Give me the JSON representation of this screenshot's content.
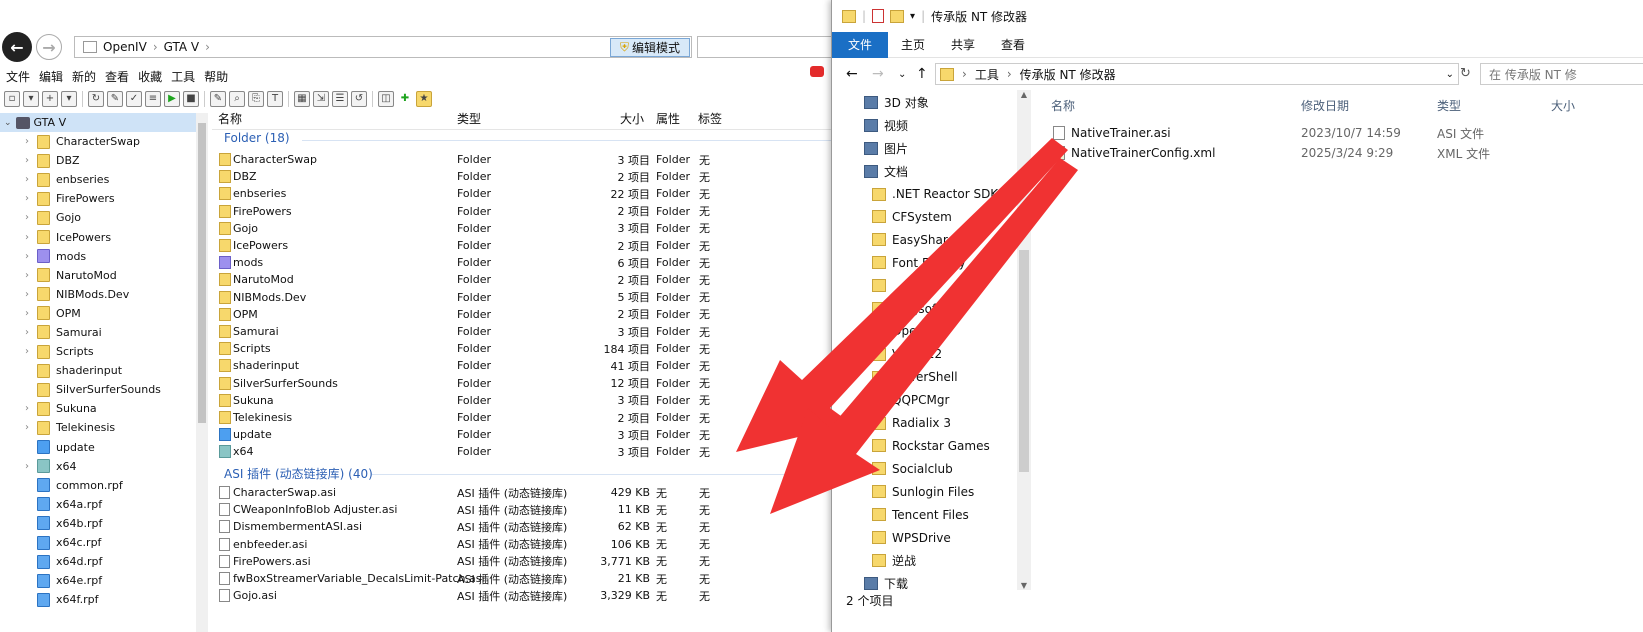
{
  "openiv": {
    "address": {
      "app": "OpenIV",
      "folder": "GTA V"
    },
    "edit_mode": "编辑模式",
    "menu": [
      "文件",
      "编辑",
      "新的",
      "查看",
      "收藏",
      "工具",
      "帮助"
    ],
    "tree_root": "GTA V",
    "tree": [
      {
        "label": "CharacterSwap",
        "icon": "folder"
      },
      {
        "label": "DBZ",
        "icon": "folder"
      },
      {
        "label": "enbseries",
        "icon": "folder"
      },
      {
        "label": "FirePowers",
        "icon": "folder"
      },
      {
        "label": "Gojo",
        "icon": "folder"
      },
      {
        "label": "IcePowers",
        "icon": "folder"
      },
      {
        "label": "mods",
        "icon": "purple"
      },
      {
        "label": "NarutoMod",
        "icon": "folder"
      },
      {
        "label": "NIBMods.Dev",
        "icon": "folder"
      },
      {
        "label": "OPM",
        "icon": "folder"
      },
      {
        "label": "Samurai",
        "icon": "folder"
      },
      {
        "label": "Scripts",
        "icon": "folder"
      },
      {
        "label": "shaderinput",
        "icon": "folder"
      },
      {
        "label": "SilverSurferSounds",
        "icon": "folder"
      },
      {
        "label": "Sukuna",
        "icon": "folder"
      },
      {
        "label": "Telekinesis",
        "icon": "folder"
      },
      {
        "label": "update",
        "icon": "blue"
      },
      {
        "label": "x64",
        "icon": "teal"
      },
      {
        "label": "common.rpf",
        "icon": "rpf"
      },
      {
        "label": "x64a.rpf",
        "icon": "rpf"
      },
      {
        "label": "x64b.rpf",
        "icon": "rpf"
      },
      {
        "label": "x64c.rpf",
        "icon": "rpf"
      },
      {
        "label": "x64d.rpf",
        "icon": "rpf"
      },
      {
        "label": "x64e.rpf",
        "icon": "rpf"
      },
      {
        "label": "x64f.rpf",
        "icon": "rpf"
      }
    ],
    "columns": {
      "name": "名称",
      "type": "类型",
      "size": "大小",
      "attr": "属性",
      "tag": "标签"
    },
    "group_folder": "Folder (18)",
    "group_asi": "ASI 插件 (动态链接库) (40)",
    "folders": [
      {
        "name": "CharacterSwap",
        "type": "Folder",
        "size": "3 项目",
        "attr": "Folder",
        "tag": "无"
      },
      {
        "name": "DBZ",
        "type": "Folder",
        "size": "2 项目",
        "attr": "Folder",
        "tag": "无"
      },
      {
        "name": "enbseries",
        "type": "Folder",
        "size": "22 项目",
        "attr": "Folder",
        "tag": "无"
      },
      {
        "name": "FirePowers",
        "type": "Folder",
        "size": "2 项目",
        "attr": "Folder",
        "tag": "无"
      },
      {
        "name": "Gojo",
        "type": "Folder",
        "size": "3 项目",
        "attr": "Folder",
        "tag": "无"
      },
      {
        "name": "IcePowers",
        "type": "Folder",
        "size": "2 项目",
        "attr": "Folder",
        "tag": "无"
      },
      {
        "name": "mods",
        "type": "Folder",
        "size": "6 项目",
        "attr": "Folder",
        "tag": "无"
      },
      {
        "name": "NarutoMod",
        "type": "Folder",
        "size": "2 项目",
        "attr": "Folder",
        "tag": "无"
      },
      {
        "name": "NIBMods.Dev",
        "type": "Folder",
        "size": "5 项目",
        "attr": "Folder",
        "tag": "无"
      },
      {
        "name": "OPM",
        "type": "Folder",
        "size": "2 项目",
        "attr": "Folder",
        "tag": "无"
      },
      {
        "name": "Samurai",
        "type": "Folder",
        "size": "3 项目",
        "attr": "Folder",
        "tag": "无"
      },
      {
        "name": "Scripts",
        "type": "Folder",
        "size": "184 项目",
        "attr": "Folder",
        "tag": "无"
      },
      {
        "name": "shaderinput",
        "type": "Folder",
        "size": "41 项目",
        "attr": "Folder",
        "tag": "无"
      },
      {
        "name": "SilverSurferSounds",
        "type": "Folder",
        "size": "12 项目",
        "attr": "Folder",
        "tag": "无"
      },
      {
        "name": "Sukuna",
        "type": "Folder",
        "size": "3 项目",
        "attr": "Folder",
        "tag": "无"
      },
      {
        "name": "Telekinesis",
        "type": "Folder",
        "size": "2 项目",
        "attr": "Folder",
        "tag": "无"
      },
      {
        "name": "update",
        "type": "Folder",
        "size": "3 项目",
        "attr": "Folder",
        "tag": "无"
      },
      {
        "name": "x64",
        "type": "Folder",
        "size": "3 项目",
        "attr": "Folder",
        "tag": "无"
      }
    ],
    "asi": [
      {
        "name": "CharacterSwap.asi",
        "type": "ASI 插件 (动态链接库)",
        "size": "429 KB",
        "attr": "无",
        "tag": "无"
      },
      {
        "name": "CWeaponInfoBlob Adjuster.asi",
        "type": "ASI 插件 (动态链接库)",
        "size": "11 KB",
        "attr": "无",
        "tag": "无"
      },
      {
        "name": "DismembermentASI.asi",
        "type": "ASI 插件 (动态链接库)",
        "size": "62 KB",
        "attr": "无",
        "tag": "无"
      },
      {
        "name": "enbfeeder.asi",
        "type": "ASI 插件 (动态链接库)",
        "size": "106 KB",
        "attr": "无",
        "tag": "无"
      },
      {
        "name": "FirePowers.asi",
        "type": "ASI 插件 (动态链接库)",
        "size": "3,771 KB",
        "attr": "无",
        "tag": "无"
      },
      {
        "name": "fwBoxStreamerVariable_DecalsLimit-Patch.asi",
        "type": "ASI 插件 (动态链接库)",
        "size": "21 KB",
        "attr": "无",
        "tag": "无"
      },
      {
        "name": "Gojo.asi",
        "type": "ASI 插件 (动态链接库)",
        "size": "3,329 KB",
        "attr": "无",
        "tag": "无"
      }
    ]
  },
  "explorer": {
    "title": "传承版 NT 修改器",
    "ribbon": [
      "文件",
      "主页",
      "共享",
      "查看"
    ],
    "path": [
      "工具",
      "传承版 NT 修改器"
    ],
    "search_placeholder": "在 传承版 NT 修",
    "nav": [
      {
        "label": "3D 对象",
        "icon": "sys",
        "indent": 0
      },
      {
        "label": "视频",
        "icon": "sys",
        "indent": 0
      },
      {
        "label": "图片",
        "icon": "sys",
        "indent": 0
      },
      {
        "label": "文档",
        "icon": "sys",
        "indent": 0
      },
      {
        "label": ".NET Reactor SDK test",
        "icon": "folder",
        "indent": 1
      },
      {
        "label": "CFSystem",
        "icon": "folder",
        "indent": 1
      },
      {
        "label": "EasyShare",
        "icon": "folder",
        "indent": 1
      },
      {
        "label": "Font Factory",
        "icon": "folder",
        "indent": 1
      },
      {
        "label": "",
        "icon": "folder",
        "indent": 1
      },
      {
        "label": "Kingsoft",
        "icon": "folder",
        "indent": 1
      },
      {
        "label": "Open",
        "icon": "folder",
        "indent": 1
      },
      {
        "label": "VS 2022",
        "icon": "folder",
        "indent": 1
      },
      {
        "label": "PowerShell",
        "icon": "folder",
        "indent": 1
      },
      {
        "label": "QQPCMgr",
        "icon": "folder",
        "indent": 1
      },
      {
        "label": "Radialix 3",
        "icon": "folder",
        "indent": 1
      },
      {
        "label": "Rockstar Games",
        "icon": "folder",
        "indent": 1
      },
      {
        "label": "Socialclub",
        "icon": "folder",
        "indent": 1
      },
      {
        "label": "Sunlogin Files",
        "icon": "folder",
        "indent": 1
      },
      {
        "label": "Tencent Files",
        "icon": "folder",
        "indent": 1
      },
      {
        "label": "WPSDrive",
        "icon": "folder",
        "indent": 1
      },
      {
        "label": "逆战",
        "icon": "folder",
        "indent": 1
      },
      {
        "label": "下载",
        "icon": "sys",
        "indent": 0
      }
    ],
    "columns": {
      "name": "名称",
      "date": "修改日期",
      "type": "类型",
      "size": "大小"
    },
    "files": [
      {
        "name": "NativeTrainer.asi",
        "date": "2023/10/7 14:59",
        "type": "ASI 文件"
      },
      {
        "name": "NativeTrainerConfig.xml",
        "date": "2025/3/24 9:29",
        "type": "XML 文件"
      }
    ],
    "status": "2 个项目"
  },
  "colors": {
    "accent": "#1a6fc5",
    "arrow": "#f03232",
    "folder": "#f7d86c"
  }
}
